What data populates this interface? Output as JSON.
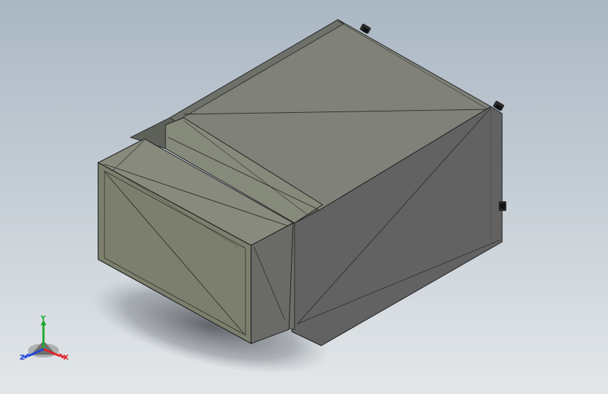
{
  "viewport": {
    "background_top": "#aab7c4",
    "background_bottom": "#e3e7ea"
  },
  "model": {
    "type": "rectangular-duct-reducer",
    "face_colors": {
      "top_face": "#80827a",
      "right_face": "#626262",
      "front_end_face": "#7d7f6e",
      "connector_top": "#868a7b",
      "edge": "#1f1f1f"
    }
  },
  "triad": {
    "x_label": "X",
    "y_label": "Y",
    "z_label": "Z",
    "x_color": "#e0232b",
    "y_color": "#1aa82b",
    "z_color": "#2345d8"
  }
}
